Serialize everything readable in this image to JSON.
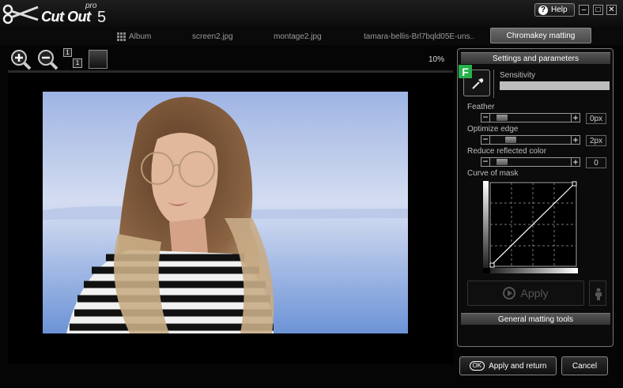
{
  "app": {
    "name": "Cut Out",
    "edition": "pro",
    "version": "5"
  },
  "titlebar": {
    "help_label": "Help",
    "minimize": "–",
    "maximize": "□",
    "close": "✕"
  },
  "tabs": [
    {
      "label": "Album",
      "icon": "grid-icon"
    },
    {
      "label": "screen2.jpg"
    },
    {
      "label": "montage2.jpg"
    },
    {
      "label": "tamara-bellis-Brl7bqld05E-uns..."
    },
    {
      "label": "Chromakey matting",
      "active": true
    }
  ],
  "toolbar": {
    "zoom_level": "10%",
    "actual_size_a": "1",
    "actual_size_b": "1"
  },
  "panel": {
    "header": "Settings and parameters",
    "badge": "F",
    "sensitivity_label": "Sensitivity",
    "feather": {
      "label": "Feather",
      "value": "0px",
      "level": 0.08
    },
    "optimize_edge": {
      "label": "Optimize edge",
      "value": "2px",
      "level": 0.2
    },
    "reduce_reflected": {
      "label": "Reduce reflected color",
      "value": "0",
      "level": 0.08
    },
    "curve_label": "Curve of mask",
    "apply_label": "Apply",
    "footer": "General matting tools"
  },
  "bottom": {
    "apply_return_icon": "OK",
    "apply_return": "Apply and return",
    "cancel": "Cancel"
  },
  "colors": {
    "badge": "#26b34a",
    "sky": "#b9cdee",
    "sea": "#6f95d8"
  }
}
